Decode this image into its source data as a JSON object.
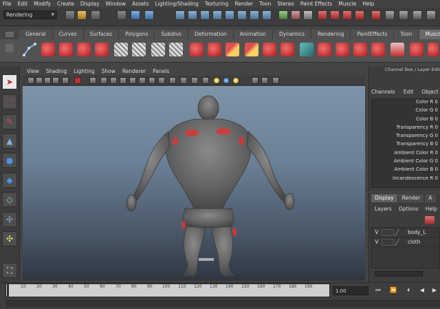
{
  "menu": [
    "File",
    "Edit",
    "Modify",
    "Create",
    "Display",
    "Window",
    "Assets",
    "Lighting/Shading",
    "Texturing",
    "Render",
    "Toon",
    "Stereo",
    "Paint Effects",
    "Muscle",
    "Help"
  ],
  "status": {
    "mode": "Rendering"
  },
  "shelf": {
    "tabs": [
      "General",
      "Curves",
      "Surfaces",
      "Polygons",
      "Subdivs",
      "Deformation",
      "Animation",
      "Dynamics",
      "Rendering",
      "PaintEffects",
      "Toon",
      "Muscle"
    ],
    "active_tab": "Muscle"
  },
  "panel": {
    "menu": [
      "View",
      "Shading",
      "Lighting",
      "Show",
      "Renderer",
      "Panels"
    ]
  },
  "channel_box": {
    "title": "Channel Box / Layer Edit",
    "tabs": [
      "Channels",
      "Edit",
      "Object"
    ],
    "rows": [
      "Color R 0",
      "Color G 0",
      "Color B 0",
      "Transparency R 0",
      "Transparency G 0",
      "Transparency B 0",
      "Ambient Color R 0",
      "Ambient Color G 0",
      "Ambient Color B 0",
      "Incandescence R 0"
    ]
  },
  "layers": {
    "tabs": [
      "Display",
      "Render",
      "A"
    ],
    "active_tab": "Display",
    "menu": [
      "Layers",
      "Options",
      "Help"
    ],
    "rows": [
      {
        "visible": "V",
        "name": "body_L"
      },
      {
        "visible": "V",
        "name": "cloth"
      }
    ]
  },
  "timeline": {
    "ticks": [
      "10",
      "20",
      "30",
      "40",
      "50",
      "60",
      "70",
      "80",
      "90",
      "100",
      "110",
      "120",
      "130",
      "140",
      "150",
      "160",
      "170",
      "180",
      "190"
    ],
    "current": "1.00"
  },
  "colors": {
    "accent_red": "#d8363a",
    "viewport_top": "#7f93a8"
  }
}
